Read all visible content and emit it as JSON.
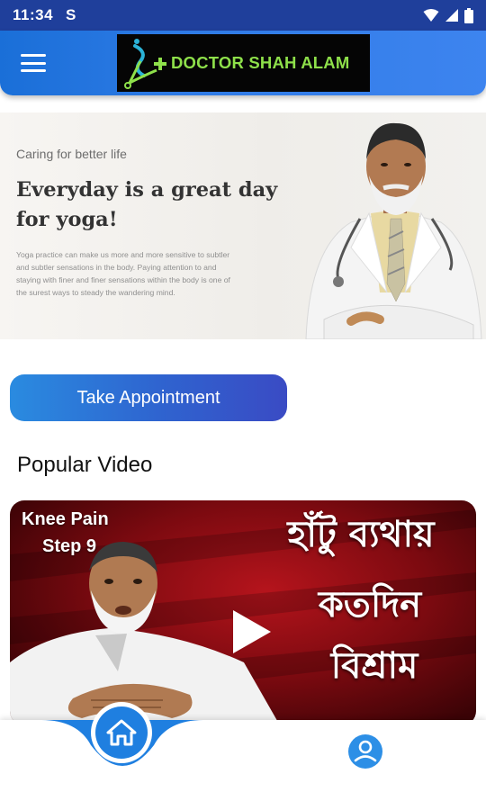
{
  "status_bar": {
    "time": "11:34",
    "app_indicator": "S",
    "icons": [
      "wifi-icon",
      "signal-icon",
      "battery-icon"
    ]
  },
  "app_bar": {
    "menu_icon": "hamburger-menu-icon",
    "logo_text": "DOCTOR SHAH ALAM"
  },
  "banner": {
    "tagline": "Caring for better life",
    "title": "Everyday is a great day for yoga!",
    "description": "Yoga practice can make us more and more sensitive to subtler and subtler sensations in the body. Paying attention to and staying with finer and finer sensations within the body is one of the surest ways to steady the wandering mind."
  },
  "appointment_button": {
    "label": "Take Appointment"
  },
  "popular_video": {
    "section_title": "Popular Video",
    "thumbnail_label_line1": "Knee Pain",
    "thumbnail_label_line2": "Step 9",
    "thumbnail_bengali_line1": "হাঁটু ব্যথায়",
    "thumbnail_bengali_line2": "কতদিন",
    "thumbnail_bengali_line3": "বিশ্রাম",
    "play_icon": "play-icon"
  },
  "bottom_nav": {
    "items": [
      {
        "icon": "home-icon",
        "active": true
      },
      {
        "icon": "profile-icon",
        "active": false
      }
    ]
  },
  "colors": {
    "status_bar": "#1f3f9b",
    "app_bar": "#2f7be6",
    "logo_green": "#8ee04a",
    "button_start": "#2a8be0",
    "button_end": "#3a4bc4",
    "nav_accent": "#1f7fe0"
  }
}
